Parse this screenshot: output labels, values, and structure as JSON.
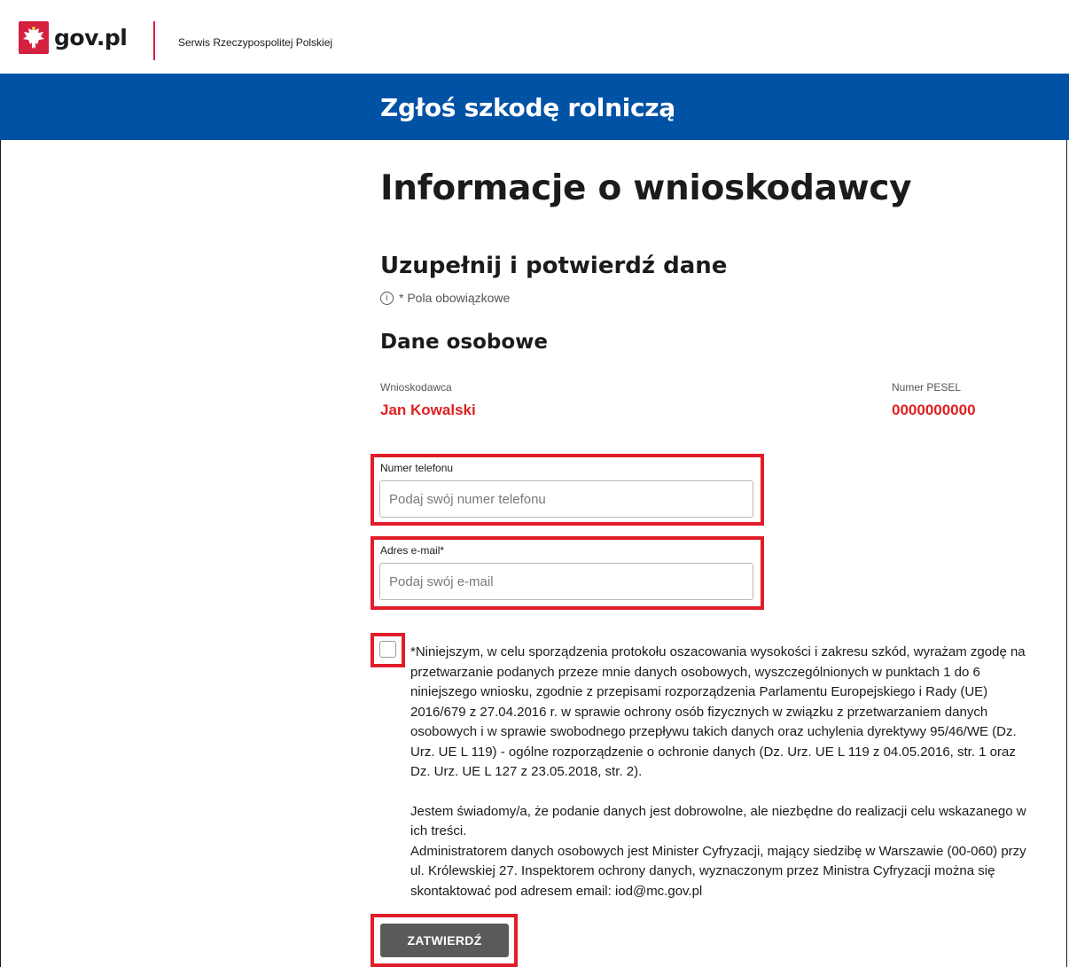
{
  "header": {
    "logo_text": "gov.pl",
    "service_name": "Serwis Rzeczypospolitej Polskiej"
  },
  "banner": {
    "title": "Zgłoś szkodę rolniczą"
  },
  "page": {
    "title": "Informacje o wnioskodawcy",
    "subtitle": "Uzupełnij i potwierdź dane",
    "required_note": "* Pola obowiązkowe",
    "section_title": "Dane osobowe"
  },
  "applicant": {
    "name_label": "Wnioskodawca",
    "name_value": "Jan Kowalski",
    "pesel_label": "Numer PESEL",
    "pesel_value": "0000000000"
  },
  "form": {
    "phone": {
      "label": "Numer telefonu",
      "placeholder": "Podaj swój numer telefonu",
      "value": ""
    },
    "email": {
      "label": "Adres e-mail*",
      "placeholder": "Podaj swój e-mail",
      "value": ""
    },
    "consent_checked": false,
    "consent_text": "*Niniejszym, w celu sporządzenia protokołu oszacowania wysokości i zakresu szkód, wyrażam zgodę na przetwarzanie podanych przeze mnie danych osobowych, wyszczególnionych w punktach 1 do 6 niniejszego wniosku, zgodnie z przepisami rozporządzenia Parlamentu Europejskiego i Rady (UE) 2016/679 z 27.04.2016 r. w sprawie ochrony osób fizycznych w związku z przetwarzaniem danych osobowych i w sprawie swobodnego przepływu takich danych oraz uchylenia dyrektywy 95/46/WE (Dz. Urz. UE L 119) - ogólne rozporządzenie o ochronie danych (Dz. Urz. UE L 119 z 04.05.2016, str. 1 oraz Dz. Urz. UE L 127 z 23.05.2018, str. 2).",
    "awareness_text": "Jestem świadomy/a, że podanie danych jest dobrowolne, ale niezbędne do realizacji celu wskazanego w ich treści.",
    "admin_text": "Administratorem danych osobowych jest Minister Cyfryzacji, mający siedzibę w Warszawie (00-060) przy ul. Królewskiej 27. Inspektorem ochrony danych, wyznaczonym przez Ministra Cyfryzacji można się skontaktować pod adresem email: iod@mc.gov.pl",
    "submit_label": "ZATWIERDŹ"
  },
  "colors": {
    "brand_blue": "#0052a5",
    "highlight_red": "#e11d2a",
    "value_red": "#e12020",
    "button_gray": "#5a5a5a"
  },
  "icons": {
    "logo": "polish-eagle-icon",
    "info": "info-icon"
  }
}
